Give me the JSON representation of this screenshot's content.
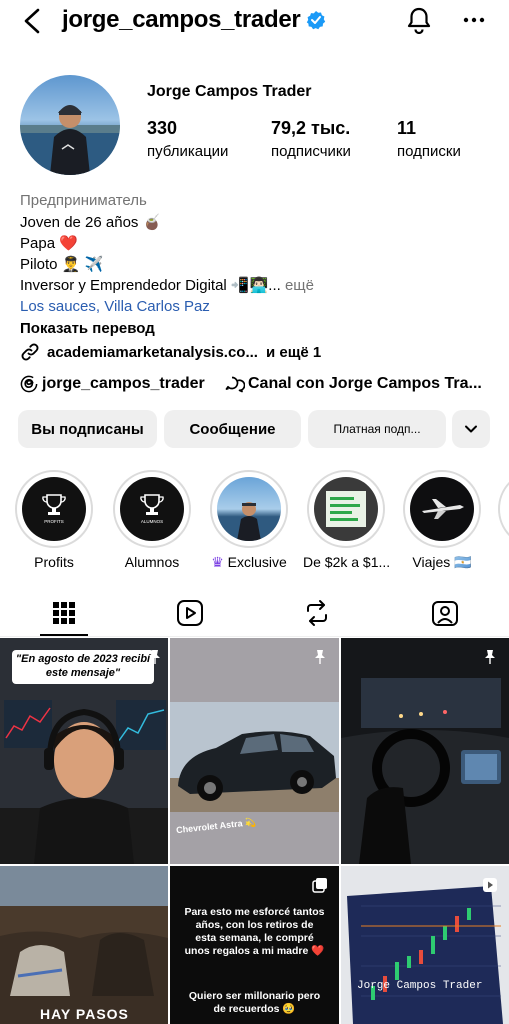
{
  "header": {
    "username": "jorge_campos_trader"
  },
  "profile": {
    "display_name": "Jorge Campos Trader",
    "stats": [
      {
        "value": "330",
        "label": "публикации"
      },
      {
        "value": "79,2 тыс.",
        "label": "подписчики"
      },
      {
        "value": "11",
        "label": "подписки"
      }
    ],
    "bio": {
      "category": "Предприниматель",
      "line1": "Joven de 26 años 🧉",
      "line2": "Papa ❤️",
      "line3": "Piloto 👨‍✈️ ✈️",
      "line4": "Inversor y Emprendedor Digital 📲👨🏻‍💻...",
      "more": " ещё",
      "location_part1": "Los sauces",
      "location_sep": ", ",
      "location_part2": "Villa Carlos Paz",
      "translate": "Показать перевод",
      "website": "academiamarketanalysis.co...",
      "website_more": "и ещё 1"
    },
    "threads": "jorge_campos_trader",
    "channel": "Canal con Jorge Campos Tra..."
  },
  "buttons": {
    "following": "Вы подписаны",
    "message": "Сообщение",
    "subscription": "Платная подп..."
  },
  "highlights": [
    {
      "label": "Profits"
    },
    {
      "label": "Alumnos"
    },
    {
      "label": "Exclusive"
    },
    {
      "label": "De $2k a $1..."
    },
    {
      "label": "Viajes 🇦🇷"
    }
  ],
  "highlight_cover_text": {
    "profits": "PROFITS",
    "alumnos": "ALUMNOS"
  },
  "posts": {
    "p1_caption": "\"En agosto de 2023 recibí este mensaje\"",
    "p2_caption": "Chevrolet Astra 💫",
    "p4_caption": "HAY PASOS",
    "p5_text1": "Para esto me esforcé tantos años, con los retiros de esta semana, le compré unos regalos a mi madre ❤️",
    "p5_text2": "Quiero ser millonario pero de recuerdos 🥹",
    "p6_caption": "Jorge Campos Trader"
  }
}
